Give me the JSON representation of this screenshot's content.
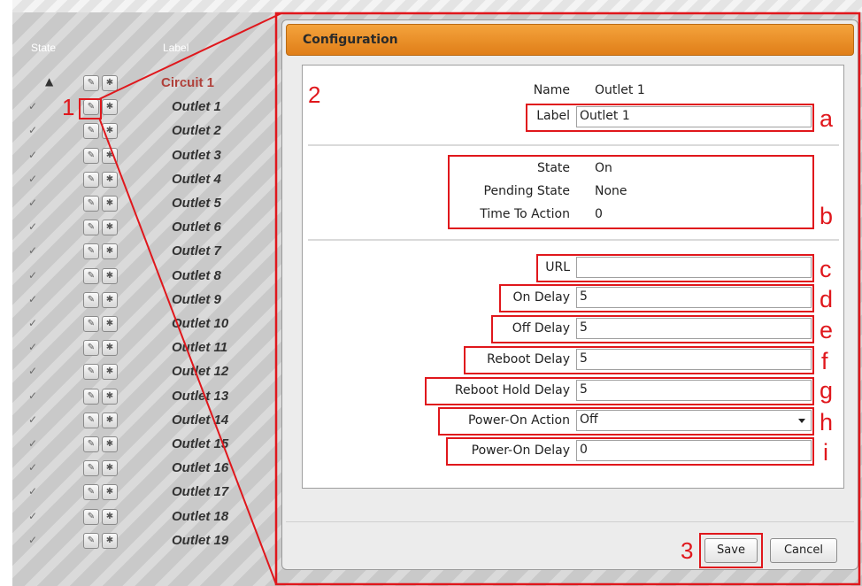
{
  "table": {
    "col_state": "State",
    "col_label": "Label",
    "circuit_label": "Circuit 1",
    "outlets": [
      "Outlet 1",
      "Outlet 2",
      "Outlet 3",
      "Outlet 4",
      "Outlet 5",
      "Outlet 6",
      "Outlet 7",
      "Outlet 8",
      "Outlet 9",
      "Outlet 10",
      "Outlet 11",
      "Outlet 12",
      "Outlet 13",
      "Outlet 14",
      "Outlet 15",
      "Outlet 16",
      "Outlet 17",
      "Outlet 18",
      "Outlet 19"
    ],
    "state_glyph": "✓",
    "wrench_glyph": "✎",
    "gear_glyph": "✱",
    "warning_glyph": "▲"
  },
  "dialog": {
    "title": "Configuration",
    "name_label": "Name",
    "name_value": "Outlet 1",
    "label_label": "Label",
    "label_value": "Outlet 1",
    "state_label": "State",
    "state_value": "On",
    "pending_label": "Pending State",
    "pending_value": "None",
    "tta_label": "Time To Action",
    "tta_value": "0",
    "url_label": "URL",
    "url_value": "",
    "on_delay_label": "On Delay",
    "on_delay_value": "5",
    "off_delay_label": "Off Delay",
    "off_delay_value": "5",
    "reboot_delay_label": "Reboot Delay",
    "reboot_delay_value": "5",
    "reboot_hold_label": "Reboot Hold Delay",
    "reboot_hold_value": "5",
    "power_on_action_label": "Power-On Action",
    "power_on_action_value": "Off",
    "power_on_delay_label": "Power-On Delay",
    "power_on_delay_value": "0",
    "save_label": "Save",
    "cancel_label": "Cancel"
  },
  "annotations": {
    "n1": "1",
    "n2": "2",
    "n3": "3",
    "a": "a",
    "b": "b",
    "c": "c",
    "d": "d",
    "e": "e",
    "f": "f",
    "g": "g",
    "h": "h",
    "i": "i"
  },
  "colors": {
    "header_orange": "#f0982f",
    "annotation_red": "#e0171c",
    "circuit_label": "#b0403a"
  }
}
